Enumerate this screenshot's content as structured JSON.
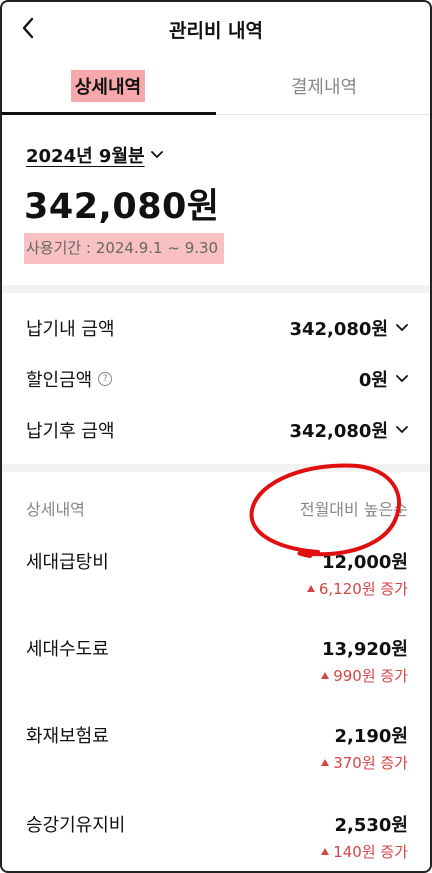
{
  "header": {
    "title": "관리비 내역"
  },
  "tabs": [
    {
      "label": "상세내역",
      "active": true
    },
    {
      "label": "결제내역",
      "active": false
    }
  ],
  "summary": {
    "period": "2024년 9월분",
    "total": "342,080원",
    "usage_period": "사용기간 : 2024.9.1 ~ 9.30"
  },
  "payments": [
    {
      "label": "납기내 금액",
      "amount": "342,080원"
    },
    {
      "label": "할인금액",
      "amount": "0원",
      "help_icon": "?"
    },
    {
      "label": "납기후 금액",
      "amount": "342,080원"
    }
  ],
  "details": {
    "section_title": "상세내역",
    "sort_label": "전월대비 높은순",
    "items": [
      {
        "name": "세대급탕비",
        "amount": "12,000원",
        "change": "6,120원 증가"
      },
      {
        "name": "세대수도료",
        "amount": "13,920원",
        "change": "990원 증가"
      },
      {
        "name": "화재보험료",
        "amount": "2,190원",
        "change": "370원 증가"
      },
      {
        "name": "승강기유지비",
        "amount": "2,530원",
        "change": "140원 증가"
      }
    ]
  },
  "colors": {
    "highlight": "#f7a8ab",
    "increase": "#d64545",
    "annotation": "#e01010"
  }
}
